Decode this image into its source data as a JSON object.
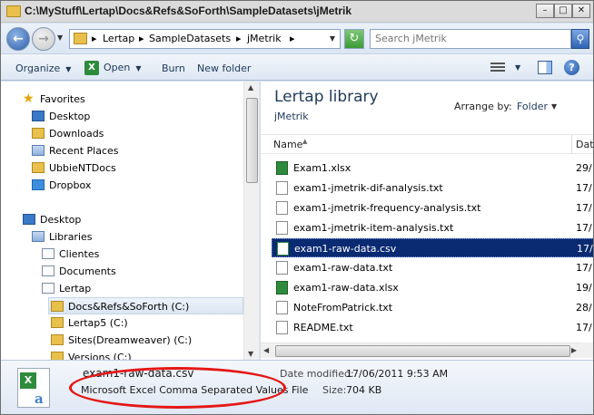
{
  "window": {
    "title": "C:\\MyStuff\\Lertap\\Docs&Refs&SoForth\\SampleDatasets\\jMetrik",
    "controls": {
      "minimize": "–",
      "maximize": "□",
      "close": "✕"
    }
  },
  "address": {
    "crumbs": [
      "Lertap",
      "SampleDatasets",
      "jMetrik"
    ],
    "separator": "▸",
    "search_placeholder": "Search jMetrik"
  },
  "toolbar": {
    "organize": "Organize",
    "open": "Open",
    "burn": "Burn",
    "new_folder": "New folder"
  },
  "nav": {
    "favorites": "Favorites",
    "desktop_fav": "Desktop",
    "downloads": "Downloads",
    "recent_places": "Recent Places",
    "ubbie": "UbbieNTDocs",
    "dropbox": "Dropbox",
    "desktop": "Desktop",
    "libraries": "Libraries",
    "clientes": "Clientes",
    "documents": "Documents",
    "lertap": "Lertap",
    "docsrefs": "Docs&Refs&SoForth (C:)",
    "lertap5": "Lertap5 (C:)",
    "sites": "Sites(Dreamweaver) (C:)",
    "versions": "Versions (C:)"
  },
  "content": {
    "library_title": "Lertap library",
    "library_subtitle": "jMetrik",
    "arrange_by_label": "Arrange by:",
    "arrange_by_value": "Folder",
    "col_name": "Name",
    "col_date": "Dat",
    "files": [
      {
        "name": "Exam1.xlsx",
        "date": "29/",
        "icon": "excel-icon"
      },
      {
        "name": "exam1-jmetrik-dif-analysis.txt",
        "date": "17/",
        "icon": "text-file-icon"
      },
      {
        "name": "exam1-jmetrik-frequency-analysis.txt",
        "date": "17/",
        "icon": "text-file-icon"
      },
      {
        "name": "exam1-jmetrik-item-analysis.txt",
        "date": "17/",
        "icon": "text-file-icon"
      },
      {
        "name": "exam1-raw-data.csv",
        "date": "17/",
        "icon": "csv-icon",
        "selected": true
      },
      {
        "name": "exam1-raw-data.txt",
        "date": "17/",
        "icon": "text-file-icon"
      },
      {
        "name": "exam1-raw-data.xlsx",
        "date": "19/",
        "icon": "excel-icon"
      },
      {
        "name": "NoteFromPatrick.txt",
        "date": "28/",
        "icon": "text-file-icon"
      },
      {
        "name": "README.txt",
        "date": "17/",
        "icon": "text-file-icon"
      }
    ]
  },
  "details": {
    "file_name": "exam1-raw-data.csv",
    "file_type": "Microsoft Excel Comma Separated Values File",
    "date_modified_label": "Date modified:",
    "date_modified_value": "17/06/2011 9:53 AM",
    "size_label": "Size:",
    "size_value": "704 KB"
  },
  "colors": {
    "selection": "#0a2a72",
    "annotation": "#e41717",
    "heading": "#1e395b"
  }
}
